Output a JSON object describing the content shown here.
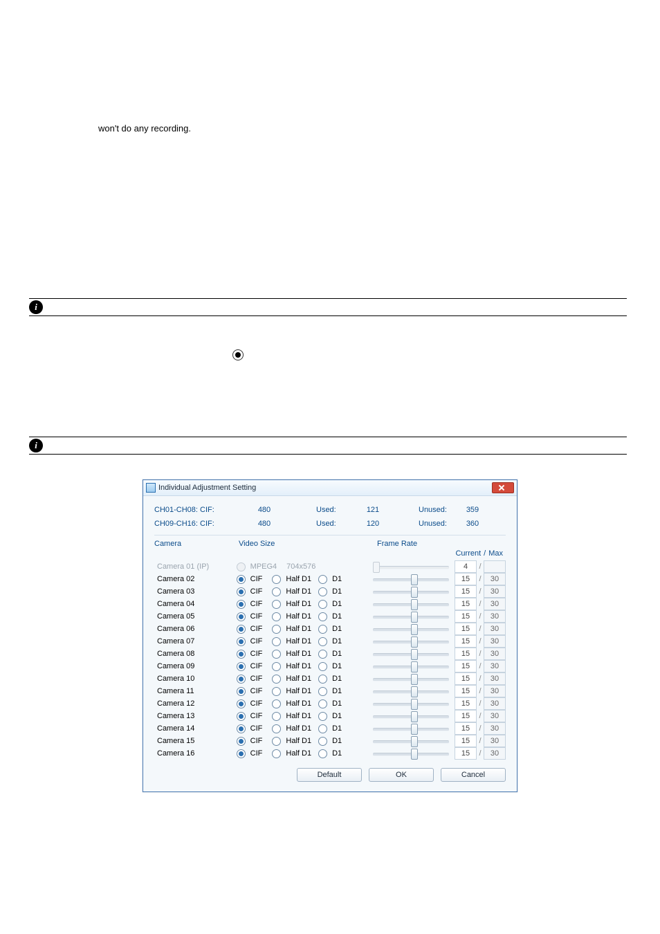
{
  "page": {
    "leading_text": "won't do any recording."
  },
  "dialog": {
    "title": "Individual Adjustment Setting",
    "summary": {
      "rows": [
        {
          "label": "CH01-CH08: CIF:",
          "total": "480",
          "used_label": "Used:",
          "used": "121",
          "unused_label": "Unused:",
          "unused": "359"
        },
        {
          "label": "CH09-CH16: CIF:",
          "total": "480",
          "used_label": "Used:",
          "used": "120",
          "unused_label": "Unused:",
          "unused": "360"
        }
      ]
    },
    "headers": {
      "camera": "Camera",
      "video_size": "Video Size",
      "frame_rate": "Frame Rate",
      "current": "Current",
      "sep": "/",
      "max": "Max"
    },
    "video_size_options": {
      "cif": "CIF",
      "half_d1": "Half D1",
      "d1": "D1"
    },
    "ip_option": {
      "codec": "MPEG4",
      "res": "704x576"
    },
    "rows": [
      {
        "name": "Camera 01 (IP)",
        "ip": true,
        "selected": null,
        "current": "4",
        "max": "",
        "disabled": true,
        "thumb_pct": 0
      },
      {
        "name": "Camera 02",
        "ip": false,
        "selected": "cif",
        "current": "15",
        "max": "30",
        "disabled": false,
        "thumb_pct": 50
      },
      {
        "name": "Camera 03",
        "ip": false,
        "selected": "cif",
        "current": "15",
        "max": "30",
        "disabled": false,
        "thumb_pct": 50
      },
      {
        "name": "Camera 04",
        "ip": false,
        "selected": "cif",
        "current": "15",
        "max": "30",
        "disabled": false,
        "thumb_pct": 50
      },
      {
        "name": "Camera 05",
        "ip": false,
        "selected": "cif",
        "current": "15",
        "max": "30",
        "disabled": false,
        "thumb_pct": 50
      },
      {
        "name": "Camera 06",
        "ip": false,
        "selected": "cif",
        "current": "15",
        "max": "30",
        "disabled": false,
        "thumb_pct": 50
      },
      {
        "name": "Camera 07",
        "ip": false,
        "selected": "cif",
        "current": "15",
        "max": "30",
        "disabled": false,
        "thumb_pct": 50
      },
      {
        "name": "Camera 08",
        "ip": false,
        "selected": "cif",
        "current": "15",
        "max": "30",
        "disabled": false,
        "thumb_pct": 50
      },
      {
        "name": "Camera 09",
        "ip": false,
        "selected": "cif",
        "current": "15",
        "max": "30",
        "disabled": false,
        "thumb_pct": 50
      },
      {
        "name": "Camera 10",
        "ip": false,
        "selected": "cif",
        "current": "15",
        "max": "30",
        "disabled": false,
        "thumb_pct": 50
      },
      {
        "name": "Camera 11",
        "ip": false,
        "selected": "cif",
        "current": "15",
        "max": "30",
        "disabled": false,
        "thumb_pct": 50
      },
      {
        "name": "Camera 12",
        "ip": false,
        "selected": "cif",
        "current": "15",
        "max": "30",
        "disabled": false,
        "thumb_pct": 50
      },
      {
        "name": "Camera 13",
        "ip": false,
        "selected": "cif",
        "current": "15",
        "max": "30",
        "disabled": false,
        "thumb_pct": 50
      },
      {
        "name": "Camera 14",
        "ip": false,
        "selected": "cif",
        "current": "15",
        "max": "30",
        "disabled": false,
        "thumb_pct": 50
      },
      {
        "name": "Camera 15",
        "ip": false,
        "selected": "cif",
        "current": "15",
        "max": "30",
        "disabled": false,
        "thumb_pct": 50
      },
      {
        "name": "Camera 16",
        "ip": false,
        "selected": "cif",
        "current": "15",
        "max": "30",
        "disabled": false,
        "thumb_pct": 50
      }
    ],
    "buttons": {
      "default": "Default",
      "ok": "OK",
      "cancel": "Cancel"
    }
  }
}
